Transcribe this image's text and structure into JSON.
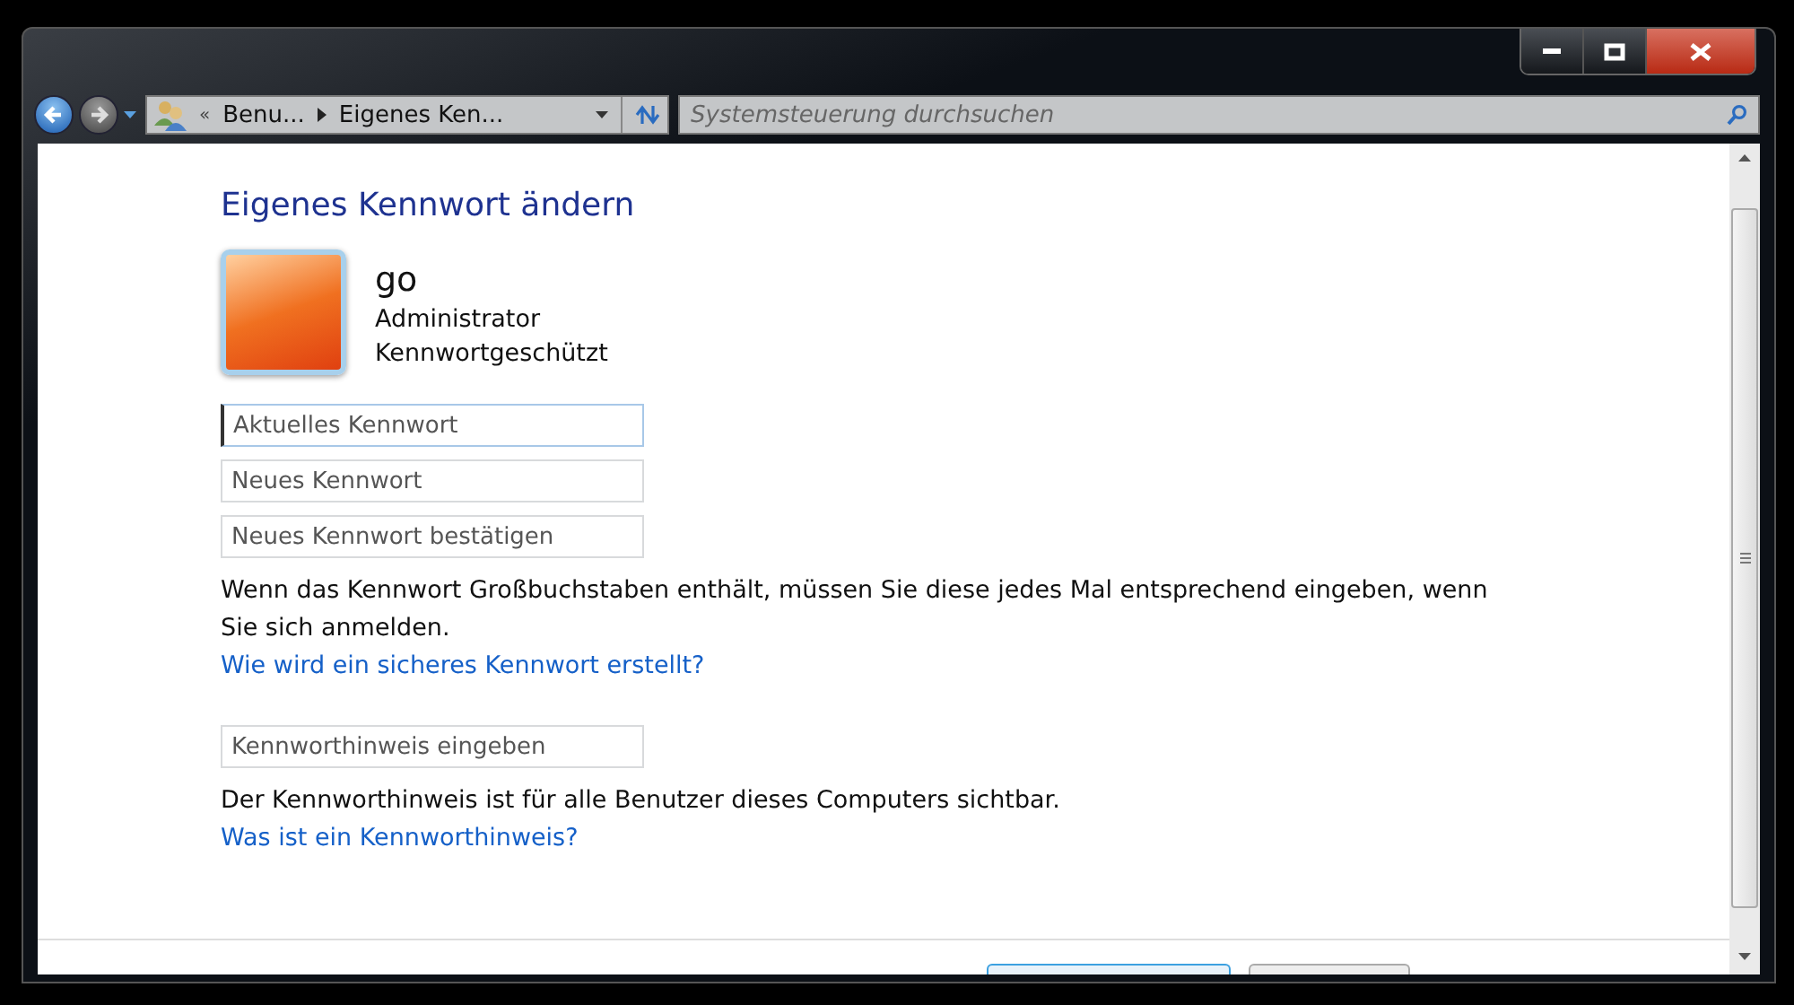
{
  "toolbar": {
    "breadcrumb_overflow": "«",
    "breadcrumb": [
      "Benu...",
      "Eigenes Ken..."
    ],
    "search": {
      "placeholder": "Systemsteuerung durchsuchen"
    }
  },
  "heading": "Eigenes Kennwort ändern",
  "user": {
    "name": "go",
    "role": "Administrator",
    "status": "Kennwortgeschützt"
  },
  "fields": [
    {
      "placeholder": "Aktuelles Kennwort",
      "focused": true
    },
    {
      "placeholder": "Neues Kennwort",
      "focused": false
    },
    {
      "placeholder": "Neues Kennwort bestätigen",
      "focused": false
    }
  ],
  "note": "Wenn das Kennwort Großbuchstaben enthält, müssen Sie diese jedes Mal entsprechend eingeben, wenn Sie sich anmelden.",
  "note_link": "Wie wird ein sicheres Kennwort erstellt?",
  "hint_field": {
    "placeholder": "Kennworthinweis eingeben",
    "focused": false
  },
  "hint_note": "Der Kennworthinweis ist für alle Benutzer dieses Computers sichtbar.",
  "hint_link": "Was ist ein Kennworthinweis?",
  "footer_buttons": [
    {
      "kind": "primary"
    },
    {
      "kind": "normal"
    }
  ]
}
